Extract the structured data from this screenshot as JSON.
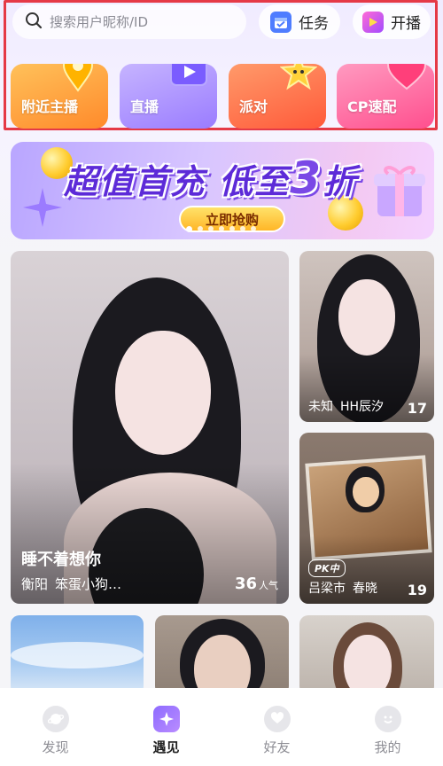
{
  "search": {
    "placeholder": "搜索用户昵称/ID"
  },
  "header": {
    "task_label": "任务",
    "live_label": "开播"
  },
  "categories": [
    {
      "label": "附近主播",
      "color": "#ffa23a"
    },
    {
      "label": "直播",
      "color": "#a58bff"
    },
    {
      "label": "派对",
      "color": "#ff6a4a"
    },
    {
      "label": "CP速配",
      "color": "#ff6aa4"
    }
  ],
  "banner": {
    "headline": "超值首充 低至",
    "highlight": "3",
    "suffix": "折",
    "button_label": "立即抢购",
    "page_index": 1,
    "page_count": 7
  },
  "cards": [
    {
      "title": "睡不着想你",
      "location": "衡阳",
      "name": "笨蛋小狗…",
      "count": "36",
      "count_unit": "人气"
    },
    {
      "location": "未知",
      "name": "HH辰汐",
      "count": "17"
    },
    {
      "tag": "PK中",
      "location": "吕梁市",
      "name": "春晓",
      "count": "19"
    }
  ],
  "nav": [
    {
      "label": "发现"
    },
    {
      "label": "遇见"
    },
    {
      "label": "好友"
    },
    {
      "label": "我的"
    }
  ],
  "accent_color": "#8e6bff",
  "highlight_box_color": "#e53946"
}
